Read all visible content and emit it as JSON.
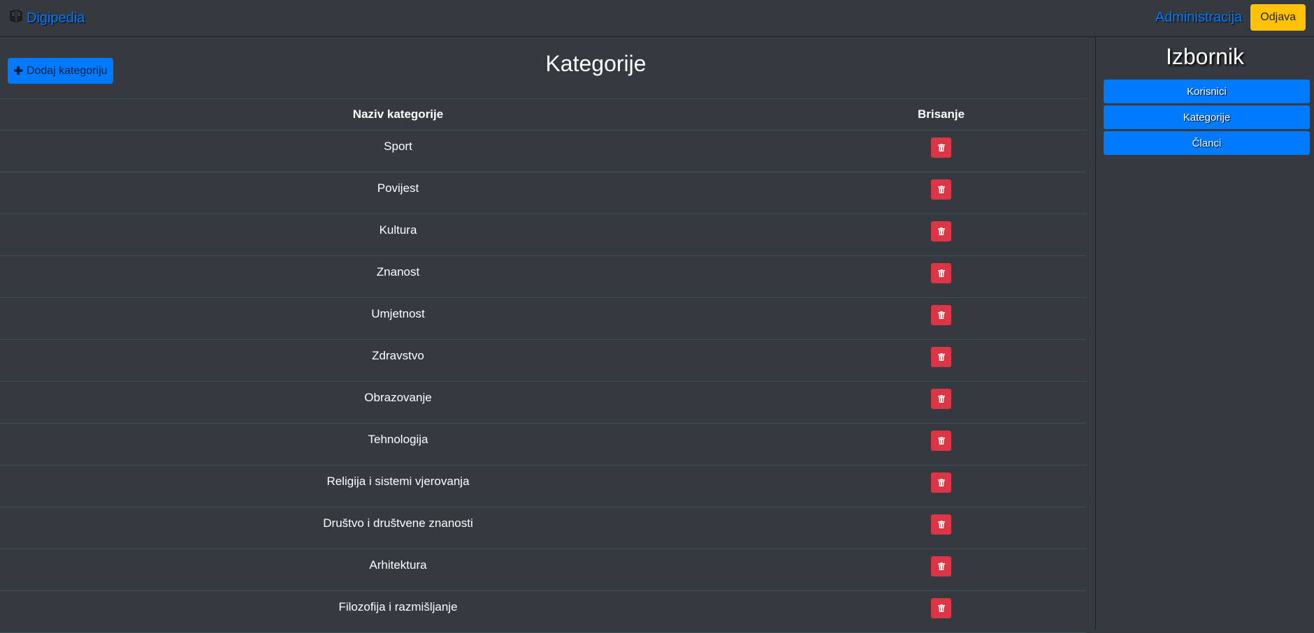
{
  "header": {
    "brand": "Digipedia",
    "admin_link": "Administracija",
    "logout_label": "Odjava"
  },
  "main": {
    "add_label": "Dodaj kategoriju",
    "title": "Kategorije",
    "columns": {
      "name": "Naziv kategorije",
      "delete": "Brisanje"
    },
    "rows": [
      "Sport",
      "Povijest",
      "Kultura",
      "Znanost",
      "Umjetnost",
      "Zdravstvo",
      "Obrazovanje",
      "Tehnologija",
      "Religija i sistemi vjerovanja",
      "Društvo i društvene znanosti",
      "Arhitektura",
      "Filozofija i razmišljanje"
    ]
  },
  "sidebar": {
    "title": "Izbornik",
    "items": [
      "Korisnici",
      "Kategorije",
      "Članci"
    ]
  },
  "colors": {
    "background": "#343a40",
    "primary": "#007bff",
    "warning": "#ffc107",
    "danger": "#dc3545"
  },
  "icons": {
    "brand": "book-icon",
    "add": "plus-icon",
    "delete": "trash-icon"
  }
}
